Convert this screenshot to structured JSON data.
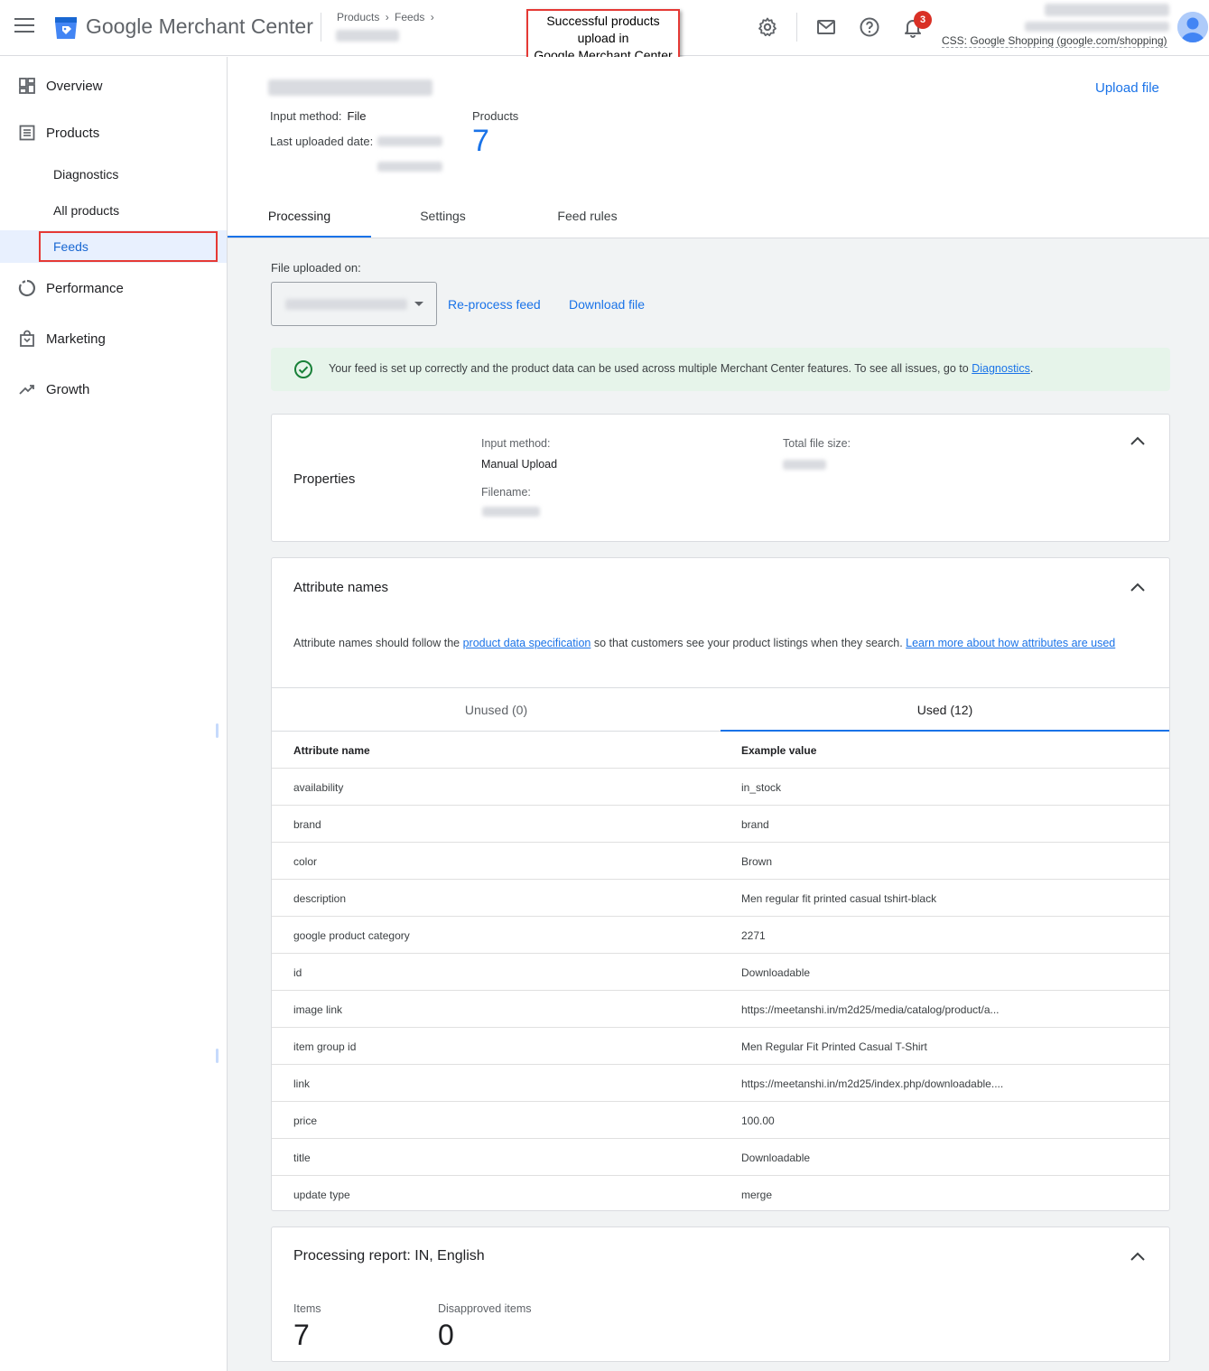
{
  "app": {
    "brand_google": "Google",
    "brand_product": "Merchant Center",
    "breadcrumb": [
      "Products",
      "Feeds"
    ],
    "annotation": [
      "Successful products",
      "upload in",
      "Google Merchant Center"
    ],
    "notification_count": "3",
    "css_label": "CSS: Google Shopping (google.com/shopping)",
    "brand_color": "#1a73e8"
  },
  "sidebar": {
    "overview": "Overview",
    "products": "Products",
    "diagnostics": "Diagnostics",
    "all_products": "All products",
    "feeds": "Feeds",
    "performance": "Performance",
    "marketing": "Marketing",
    "growth": "Growth"
  },
  "feed": {
    "upload_file": "Upload file",
    "input_method_label": "Input method:",
    "input_method_value": "File",
    "last_uploaded_label": "Last uploaded date:",
    "products_label": "Products",
    "products_count": "7"
  },
  "tabs": {
    "processing": "Processing",
    "settings": "Settings",
    "feed_rules": "Feed rules"
  },
  "processing": {
    "file_uploaded_label": "File uploaded on:",
    "reprocess": "Re-process feed",
    "download": "Download file",
    "success_text": "Your feed is set up correctly and the product data can be used across multiple Merchant Center features. To see all issues, go to ",
    "success_link": "Diagnostics",
    "success_end": "."
  },
  "properties": {
    "title": "Properties",
    "input_method_label": "Input method:",
    "input_method_value": "Manual Upload",
    "filename_label": "Filename:",
    "total_size_label": "Total file size:"
  },
  "attributes": {
    "title": "Attribute names",
    "desc_pre": "Attribute names should follow the ",
    "desc_link1": "product data specification",
    "desc_mid": " so that customers see your product listings when they search. ",
    "desc_link2": "Learn more about how attributes are used",
    "tab_unused": "Unused (0)",
    "tab_used": "Used (12)",
    "col_name": "Attribute name",
    "col_example": "Example value",
    "rows": [
      [
        "availability",
        "in_stock"
      ],
      [
        "brand",
        "brand"
      ],
      [
        "color",
        "Brown"
      ],
      [
        "description",
        "Men regular fit printed casual tshirt-black"
      ],
      [
        "google product category",
        "2271"
      ],
      [
        "id",
        "Downloadable"
      ],
      [
        "image link",
        "https://meetanshi.in/m2d25/media/catalog/product/a..."
      ],
      [
        "item group id",
        "Men Regular Fit Printed Casual T-Shirt"
      ],
      [
        "link",
        "https://meetanshi.in/m2d25/index.php/downloadable...."
      ],
      [
        "price",
        "100.00"
      ],
      [
        "title",
        "Downloadable"
      ],
      [
        "update type",
        "merge"
      ]
    ]
  },
  "report": {
    "title": "Processing report: IN, English",
    "items_label": "Items",
    "items_value": "7",
    "disapproved_label": "Disapproved items",
    "disapproved_value": "0"
  }
}
